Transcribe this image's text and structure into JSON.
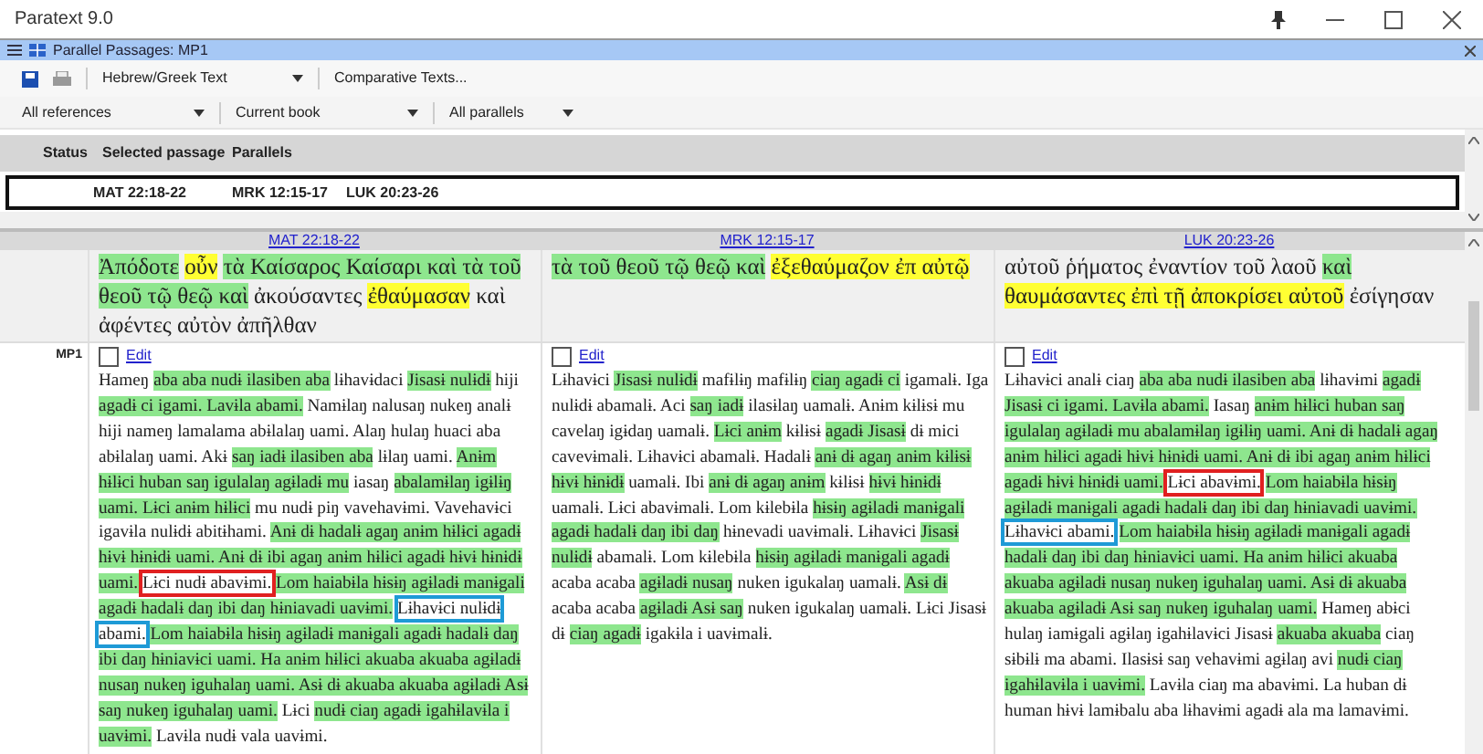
{
  "window": {
    "title": "Paratext 9.0"
  },
  "panel": {
    "title": "Parallel Passages: MP1"
  },
  "toolbar": {
    "text_dropdown": "Hebrew/Greek Text",
    "comparative_button": "Comparative Texts..."
  },
  "filters": [
    "All references",
    "Current book",
    "All parallels"
  ],
  "table": {
    "columns": [
      "Status",
      "Selected passage",
      "Parallels"
    ],
    "rows": [
      {
        "selected": true,
        "passage": "MAT 22:18-22",
        "parallels": [
          "MRK 12:15-17",
          "LUK 20:23-26"
        ]
      }
    ]
  },
  "comparison": {
    "headers": [
      "MAT 22:18-22",
      "MRK 12:15-17",
      "LUK 20:23-26"
    ],
    "source": [
      {
        "lines": [
          [
            {
              "text": "Ἀπόδοτε",
              "kind": "shared"
            },
            {
              "text": "οὖν",
              "kind": "unique"
            },
            {
              "text": "τὰ Καίσαρος Καίσαρι καὶ τὰ τοῦ",
              "kind": "shared"
            }
          ],
          [
            {
              "text": "θεοῦ τῷ θεῷ καὶ",
              "kind": "shared"
            },
            {
              "text": "ἀκούσαντες",
              "kind": "plain"
            },
            {
              "text": "ἐθαύμασαν",
              "kind": "unique"
            },
            {
              "text": "καὶ",
              "kind": "plain"
            }
          ],
          [
            {
              "text": "ἀφέντες αὐτὸν ἀπῆλθαν",
              "kind": "plain"
            }
          ]
        ]
      },
      {
        "lines": [
          [
            {
              "text": "τὰ τοῦ θεοῦ τῷ θεῷ καὶ",
              "kind": "shared"
            },
            {
              "text": "ἐξεθαύμαζον ἐπ αὐτῷ",
              "kind": "unique"
            }
          ]
        ]
      },
      {
        "lines": [
          [
            {
              "text": "αὐτοῦ ῥήματος ἐναντίον τοῦ λαοῦ",
              "kind": "plain"
            },
            {
              "text": "καὶ",
              "kind": "shared"
            }
          ],
          [
            {
              "text": "θαυμάσαντες ἐπὶ τῇ ἀποκρίσει αὐτοῦ",
              "kind": "unique"
            },
            {
              "text": "ἐσίγησαν",
              "kind": "plain"
            }
          ]
        ]
      }
    ],
    "project": {
      "label": "MP1",
      "columns": [
        {
          "checked": false,
          "edit_link": "Edit",
          "lines": [
            [
              {
                "text": "Hameŋ",
                "kind": "plain"
              },
              {
                "text": "aba aba nudɨ ilasiben aba",
                "kind": "shared"
              },
              {
                "text": "lɨhavɨdaci",
                "kind": "plain"
              },
              {
                "text": "Jisasɨ nulɨdɨ",
                "kind": "shared"
              },
              {
                "text": "hiji",
                "kind": "plain"
              }
            ],
            [
              {
                "text": "agadɨ ci igami. Lavɨla abami.",
                "kind": "shared"
              },
              {
                "text": "Namɨlaŋ nalusaŋ nukeŋ analɨ",
                "kind": "plain"
              }
            ],
            [
              {
                "text": "hiji nameŋ lamalama abɨlalaŋ uami. Alaŋ hulaŋ huaci aba",
                "kind": "plain"
              }
            ],
            [
              {
                "text": "abɨlalaŋ uami. Akɨ",
                "kind": "plain"
              },
              {
                "text": "saŋ iadɨ ilasiben aba",
                "kind": "shared"
              },
              {
                "text": "lɨlaŋ uami.",
                "kind": "plain"
              },
              {
                "text": "Anɨm",
                "kind": "shared"
              }
            ],
            [
              {
                "text": "hɨlɨci huban saŋ igulalaŋ agɨladɨ mu",
                "kind": "shared"
              },
              {
                "text": "iasaŋ",
                "kind": "plain"
              },
              {
                "text": "abalamɨlaŋ igɨlɨŋ",
                "kind": "shared"
              }
            ],
            [
              {
                "text": "uami. Lɨci anɨm hɨlɨci",
                "kind": "shared"
              },
              {
                "text": "mu nudɨ piŋ vavehavɨmi. Vavehavɨci",
                "kind": "plain"
              }
            ],
            [
              {
                "text": "igavɨla nulɨdɨ abitɨhami.",
                "kind": "plain"
              },
              {
                "text": "Anɨ dɨ hadalɨ agaŋ anɨm hɨlɨci agadɨ",
                "kind": "shared"
              }
            ],
            [
              {
                "text": "hɨvɨ hɨnɨdɨ uami. Anɨ dɨ ibi agaŋ anɨm hɨlɨci agadɨ hɨvɨ hɨnɨdɨ",
                "kind": "shared"
              }
            ],
            [
              {
                "text": "uami.",
                "kind": "shared"
              },
              {
                "text": "Lɨci nudɨ abavɨmi.",
                "kind": "plain",
                "color": "#e02020"
              },
              {
                "text": "Lom haiabɨla hɨsɨŋ agɨladɨ manɨgali",
                "kind": "shared"
              }
            ],
            [
              {
                "text": "agadɨ hadalɨ daŋ ibi daŋ hɨniavadi uavɨmi.",
                "kind": "shared"
              },
              {
                "text": "Lɨhavɨci nulɨdɨ",
                "kind": "plain",
                "color": "#1e9ad6"
              }
            ],
            [
              {
                "text": "abami.",
                "kind": "plain",
                "color": "#1e9ad6"
              },
              {
                "text": "Lom haiabɨla hɨsɨŋ agɨladɨ manɨgali agadɨ hadalɨ daŋ",
                "kind": "shared"
              }
            ],
            [
              {
                "text": "ibi daŋ hɨniavɨci uami. Ha anɨm hɨlɨci akuaba akuaba agɨladɨ",
                "kind": "shared"
              }
            ],
            [
              {
                "text": "nusaŋ nukeŋ iguhalaŋ uami. Asɨ dɨ akuaba akuaba agɨladɨ Asɨ",
                "kind": "shared"
              }
            ],
            [
              {
                "text": "saŋ nukeŋ iguhalaŋ uami.",
                "kind": "shared"
              },
              {
                "text": "Lɨci",
                "kind": "plain"
              },
              {
                "text": "nudɨ ciaŋ agadɨ igahɨlavɨla i",
                "kind": "shared"
              }
            ],
            [
              {
                "text": "uavɨmi.",
                "kind": "shared"
              },
              {
                "text": "Lavɨla nudɨ vala uavɨmi.",
                "kind": "plain"
              }
            ]
          ]
        },
        {
          "checked": false,
          "edit_link": "Edit",
          "lines": [
            [
              {
                "text": "Lɨhavɨci",
                "kind": "plain"
              },
              {
                "text": "Jisasɨ nulɨdɨ",
                "kind": "shared"
              },
              {
                "text": "mafɨlɨŋ mafɨlɨŋ",
                "kind": "plain"
              },
              {
                "text": "ciaŋ agadɨ ci",
                "kind": "shared"
              },
              {
                "text": "igamalɨ. Iga",
                "kind": "plain"
              }
            ],
            [
              {
                "text": "nulɨdɨ abamalɨ. Aci",
                "kind": "plain"
              },
              {
                "text": "saŋ iadɨ",
                "kind": "shared"
              },
              {
                "text": "ilasɨlaŋ uamalɨ. Anɨm kɨlɨsɨ mu",
                "kind": "plain"
              }
            ],
            [
              {
                "text": "cavelaŋ igɨdaŋ uamalɨ.",
                "kind": "plain"
              },
              {
                "text": "Lɨci anɨm",
                "kind": "shared"
              },
              {
                "text": "kɨlɨsɨ",
                "kind": "plain"
              },
              {
                "text": "agadɨ Jisasɨ",
                "kind": "shared"
              },
              {
                "text": "dɨ mici",
                "kind": "plain"
              }
            ],
            [
              {
                "text": "cavevɨmalɨ. Lɨhavɨci abamalɨ. Hadalɨ",
                "kind": "plain"
              },
              {
                "text": "anɨ dɨ agaŋ anɨm kɨlɨsɨ",
                "kind": "shared"
              }
            ],
            [
              {
                "text": "hɨvɨ hɨnɨdɨ",
                "kind": "shared"
              },
              {
                "text": "uamalɨ. Ibi",
                "kind": "plain"
              },
              {
                "text": "anɨ dɨ agaŋ anɨm",
                "kind": "shared"
              },
              {
                "text": "kɨlɨsɨ",
                "kind": "plain"
              },
              {
                "text": "hɨvɨ hɨnɨdɨ",
                "kind": "shared"
              }
            ],
            [
              {
                "text": "uamalɨ. Lɨci abavɨmalɨ. Lom kɨlebɨla",
                "kind": "plain"
              },
              {
                "text": "hɨsɨŋ agɨladɨ manɨgali",
                "kind": "shared"
              }
            ],
            [
              {
                "text": "agadɨ hadalɨ daŋ ibi daŋ",
                "kind": "shared"
              },
              {
                "text": "hɨnevadi uavɨmalɨ. Lɨhavɨci",
                "kind": "plain"
              },
              {
                "text": "Jisasɨ",
                "kind": "shared"
              }
            ],
            [
              {
                "text": "nulɨdɨ",
                "kind": "shared"
              },
              {
                "text": "abamalɨ. Lom kɨlebɨla",
                "kind": "plain"
              },
              {
                "text": "hɨsɨŋ agɨladɨ manɨgali agadɨ",
                "kind": "shared"
              }
            ],
            [
              {
                "text": "acaba acaba",
                "kind": "plain"
              },
              {
                "text": "agɨladɨ nusaŋ",
                "kind": "shared"
              },
              {
                "text": "nuken igukalaŋ uamalɨ.",
                "kind": "plain"
              },
              {
                "text": "Asɨ dɨ",
                "kind": "shared"
              }
            ],
            [
              {
                "text": "acaba acaba",
                "kind": "plain"
              },
              {
                "text": "agɨladɨ Asɨ saŋ",
                "kind": "shared"
              },
              {
                "text": "nuken igukalaŋ uamalɨ. Lɨci Jisasɨ",
                "kind": "plain"
              }
            ],
            [
              {
                "text": "dɨ",
                "kind": "plain"
              },
              {
                "text": "ciaŋ agadɨ",
                "kind": "shared"
              },
              {
                "text": "igakɨla i uavɨmalɨ.",
                "kind": "plain"
              }
            ]
          ]
        },
        {
          "checked": false,
          "edit_link": "Edit",
          "lines": [
            [
              {
                "text": "Lɨhavɨci analɨ ciaŋ",
                "kind": "plain"
              },
              {
                "text": "aba aba nudɨ ilasiben aba",
                "kind": "shared"
              },
              {
                "text": "lɨhavɨmi",
                "kind": "plain"
              },
              {
                "text": "agadɨ",
                "kind": "shared"
              }
            ],
            [
              {
                "text": "Jisasɨ ci igami. Lavɨla abami.",
                "kind": "shared"
              },
              {
                "text": "Iasaŋ",
                "kind": "plain"
              },
              {
                "text": "anɨm hɨlɨci huban saŋ",
                "kind": "shared"
              }
            ],
            [
              {
                "text": "igulalaŋ agɨladɨ mu abalamɨlaŋ igɨlɨŋ uami. Anɨ dɨ hadalɨ agaŋ",
                "kind": "shared"
              }
            ],
            [
              {
                "text": "anɨm hɨlɨci agadɨ hɨvɨ hɨnɨdɨ uami. Anɨ dɨ ibi agaŋ anɨm hɨlɨci",
                "kind": "shared"
              }
            ],
            [
              {
                "text": "agadɨ hɨvɨ hɨnɨdɨ uami.",
                "kind": "shared"
              },
              {
                "text": "Lɨci abavɨmi.",
                "kind": "plain",
                "color": "#e02020"
              },
              {
                "text": "Lom haiabɨla hɨsɨŋ",
                "kind": "shared"
              }
            ],
            [
              {
                "text": "agɨladɨ manɨgali agadɨ hadalɨ daŋ ibi daŋ hɨniavadi uavɨmi.",
                "kind": "shared"
              }
            ],
            [
              {
                "text": "Lɨhavɨci abami.",
                "kind": "plain",
                "color": "#1e9ad6"
              },
              {
                "text": "Lom haiabɨla hɨsɨŋ agɨladɨ manɨgali agadɨ",
                "kind": "shared"
              }
            ],
            [
              {
                "text": "hadalɨ daŋ ibi daŋ hɨniavɨci uami. Ha anɨm hɨlɨci akuaba",
                "kind": "shared"
              }
            ],
            [
              {
                "text": "akuaba agɨladɨ nusaŋ nukeŋ iguhalaŋ uami. Asɨ dɨ akuaba",
                "kind": "shared"
              }
            ],
            [
              {
                "text": "akuaba agɨladɨ Asɨ saŋ nukeŋ iguhalaŋ uami.",
                "kind": "shared"
              },
              {
                "text": "Hameŋ abɨci",
                "kind": "plain"
              }
            ],
            [
              {
                "text": "hulaŋ iamɨgali agɨlaŋ igahɨlavɨci Jisasɨ",
                "kind": "plain"
              },
              {
                "text": "akuaba akuaba",
                "kind": "shared"
              },
              {
                "text": "ciaŋ",
                "kind": "plain"
              }
            ],
            [
              {
                "text": "sɨbɨlɨ ma abami. Ilasɨsɨ saŋ vehavɨmi agɨlaŋ avi",
                "kind": "plain"
              },
              {
                "text": "nudɨ ciaŋ",
                "kind": "shared"
              }
            ],
            [
              {
                "text": "igahɨlavɨla i uavɨmi.",
                "kind": "shared"
              },
              {
                "text": "Lavɨla ciaŋ ma abavɨmi. La huban dɨ",
                "kind": "plain"
              }
            ],
            [
              {
                "text": "human hɨvɨ lamɨbalu aba lɨhavɨmi agadɨ ala ma lamavɨmi.",
                "kind": "plain"
              }
            ]
          ]
        }
      ]
    }
  }
}
